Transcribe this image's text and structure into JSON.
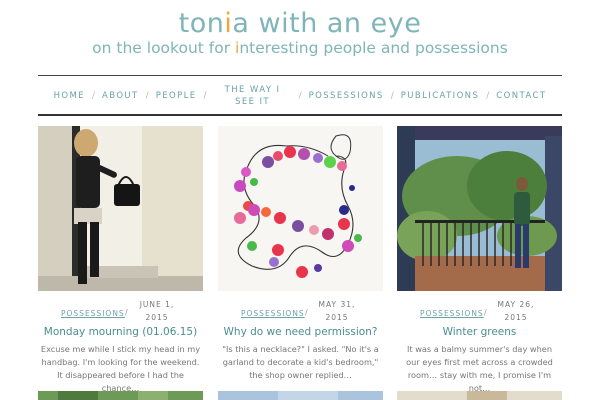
{
  "header": {
    "title_pre": "ton",
    "title_i": "i",
    "title_post": "a with an eye",
    "tagline_pre": "on the lookout for ",
    "tagline_i": "i",
    "tagline_post": "nteresting people and possessions"
  },
  "nav": {
    "items": [
      "HOME",
      "ABOUT",
      "PEOPLE",
      "THE WAY I SEE IT",
      "POSSESSIONS",
      "PUBLICATIONS",
      "CONTACT"
    ]
  },
  "posts": [
    {
      "category": "POSSESSIONS",
      "date_line1": "JUNE 1,",
      "date_line2": "2015",
      "title": "Monday mourning (01.06.15)",
      "excerpt": "Excuse me while I stick my head in my handbag. I'm looking for the weekend. It disappeared before I had the chance…",
      "image": "woman-with-handbag-photo"
    },
    {
      "category": "POSSESSIONS",
      "date_line1": "MAY 31,",
      "date_line2": "2015",
      "title": "Why do we need permission?",
      "excerpt": "\"Is this a necklace?\" I asked. \"No it's a garland to decorate a kid's bedroom,\" the shop owner replied…",
      "image": "felt-ball-garland-photo"
    },
    {
      "category": "POSSESSIONS",
      "date_line1": "MAY 26,",
      "date_line2": "2015",
      "title": "Winter greens",
      "excerpt": "It was a balmy summer's day when our eyes first met across a crowded room… stay with me, I promise I'm not…",
      "image": "woman-on-balcony-palms-photo"
    }
  ],
  "colors": {
    "accent": "#7fb5b9",
    "accent_i": "#f0a640",
    "link": "#4b8d93"
  }
}
